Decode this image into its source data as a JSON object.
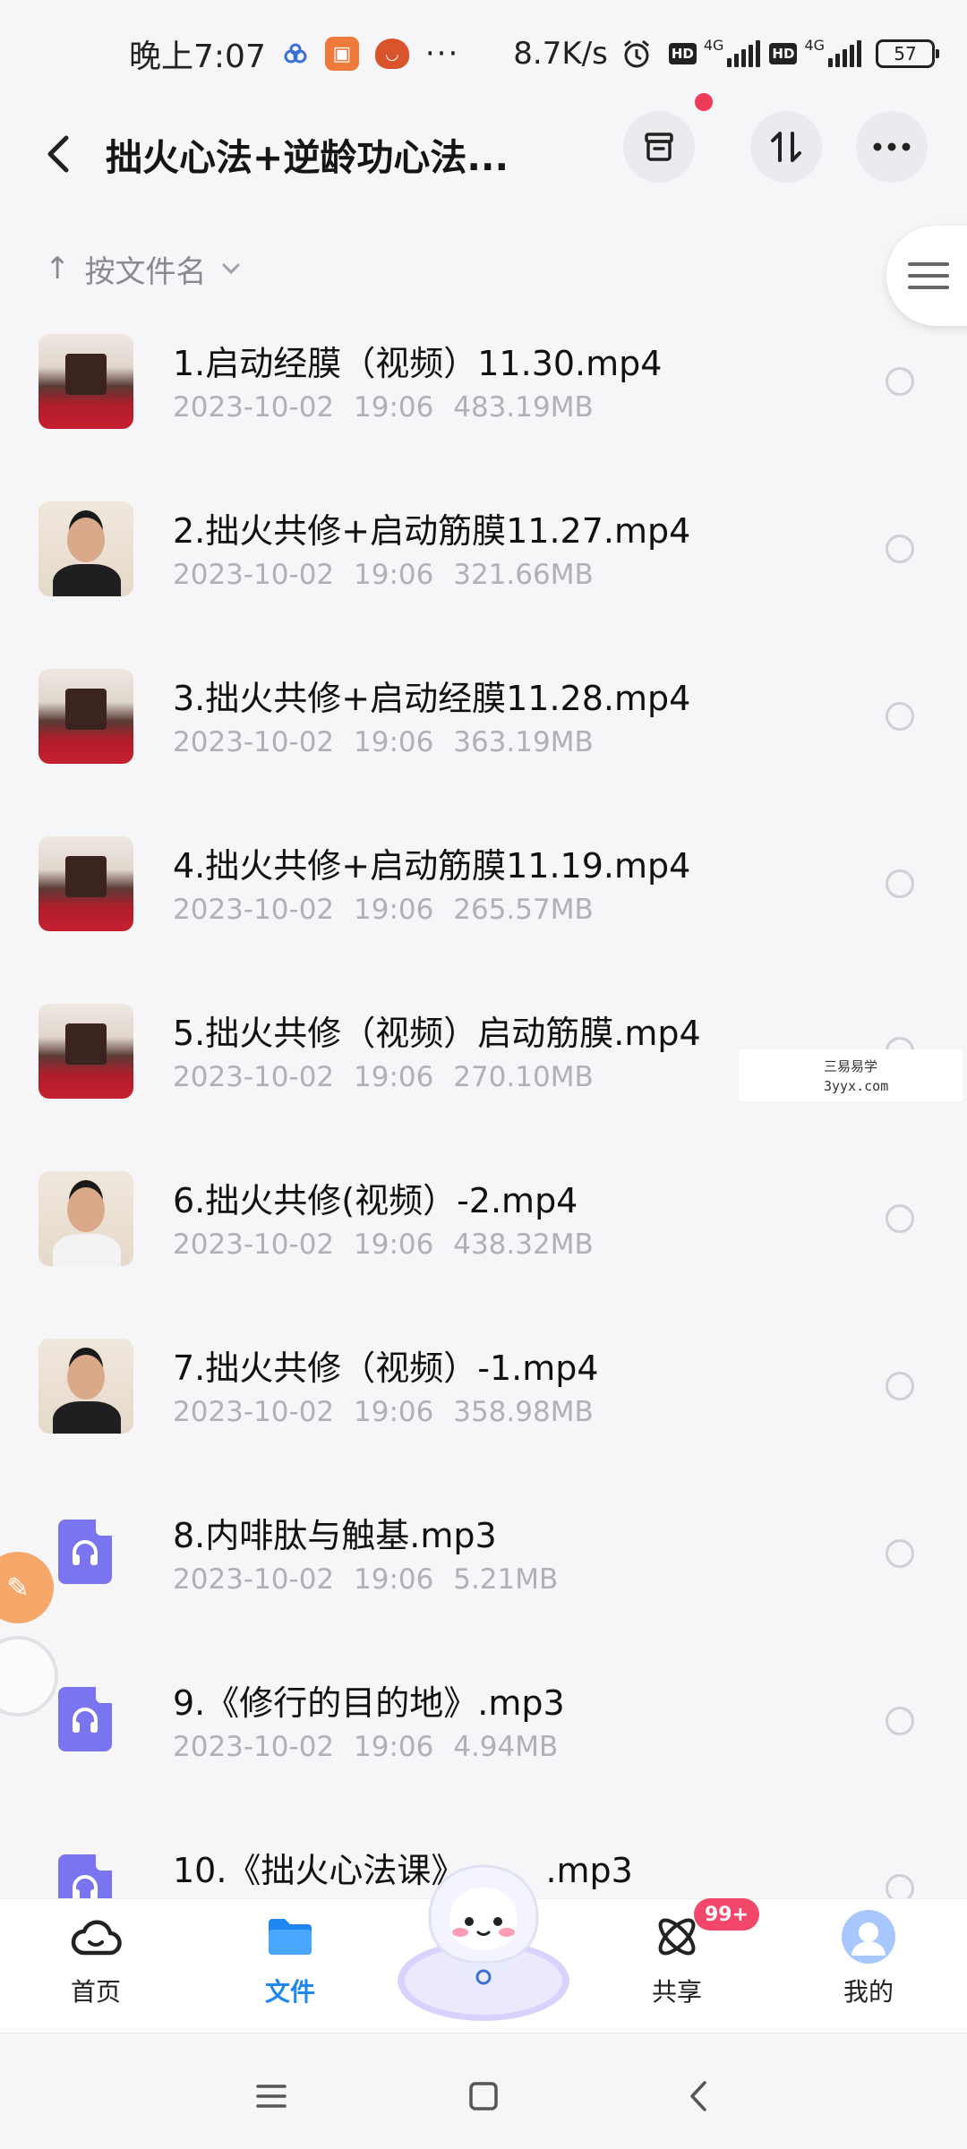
{
  "status_bar": {
    "time": "晚上7:07",
    "icons": [
      "link-icon",
      "app-notification-icon",
      "pumpkin-app-icon"
    ],
    "more": "···",
    "net_speed": "8.7K/s",
    "sim1": {
      "hd": "HD",
      "network": "4G"
    },
    "sim2": {
      "hd": "HD",
      "network": "4G"
    },
    "battery": "57"
  },
  "title_bar": {
    "title": "拙火心法+逆龄功心法...",
    "icons": [
      "back-icon",
      "archive-box-icon",
      "sort-icon",
      "more-icon"
    ]
  },
  "sort": {
    "arrow": "↑",
    "label": "按文件名",
    "chevron": "⌄"
  },
  "files": [
    {
      "name": "1.启动经膜（视频）11.30.mp4",
      "date": "2023-10-02",
      "time": "19:06",
      "size": "483.19MB",
      "thumb": "video-room"
    },
    {
      "name": "2.拙火共修+启动筋膜11.27.mp4",
      "date": "2023-10-02",
      "time": "19:06",
      "size": "321.66MB",
      "thumb": "face"
    },
    {
      "name": "3.拙火共修+启动经膜11.28.mp4",
      "date": "2023-10-02",
      "time": "19:06",
      "size": "363.19MB",
      "thumb": "video-room"
    },
    {
      "name": "4.拙火共修+启动筋膜11.19.mp4",
      "date": "2023-10-02",
      "time": "19:06",
      "size": "265.57MB",
      "thumb": "video-room"
    },
    {
      "name": "5.拙火共修（视频）启动筋膜.mp4",
      "date": "2023-10-02",
      "time": "19:06",
      "size": "270.10MB",
      "thumb": "video-room"
    },
    {
      "name": "6.拙火共修(视频）-2.mp4",
      "date": "2023-10-02",
      "time": "19:06",
      "size": "438.32MB",
      "thumb": "face-light"
    },
    {
      "name": "7.拙火共修（视频）-1.mp4",
      "date": "2023-10-02",
      "time": "19:06",
      "size": "358.98MB",
      "thumb": "face"
    },
    {
      "name": "8.内啡肽与触基.mp3",
      "date": "2023-10-02",
      "time": "19:06",
      "size": "5.21MB",
      "thumb": "audio"
    },
    {
      "name": "9.《修行的目的地》.mp3",
      "date": "2023-10-02",
      "time": "19:06",
      "size": "4.94MB",
      "thumb": "audio"
    },
    {
      "name": "10.《拙火心法课》",
      "date": "",
      "time": "",
      "size": "",
      "thumb": "audio",
      "name_tail": ".mp3"
    }
  ],
  "watermark": {
    "line1": "三易易学",
    "line2": "3yyx.com"
  },
  "bottom_nav": {
    "items": [
      {
        "label": "首页",
        "icon": "cloud-icon",
        "active": false
      },
      {
        "label": "文件",
        "icon": "folder-icon",
        "active": true
      },
      {
        "label": "共享",
        "icon": "atom-icon",
        "active": false
      },
      {
        "label": "我的",
        "icon": "avatar-icon",
        "active": false
      }
    ],
    "share_badge": "99+"
  },
  "colors": {
    "accent": "#1e88f0",
    "badge": "#f2466a",
    "audio_icon": "#7b74f0",
    "meta_text": "#b0b0b6"
  }
}
